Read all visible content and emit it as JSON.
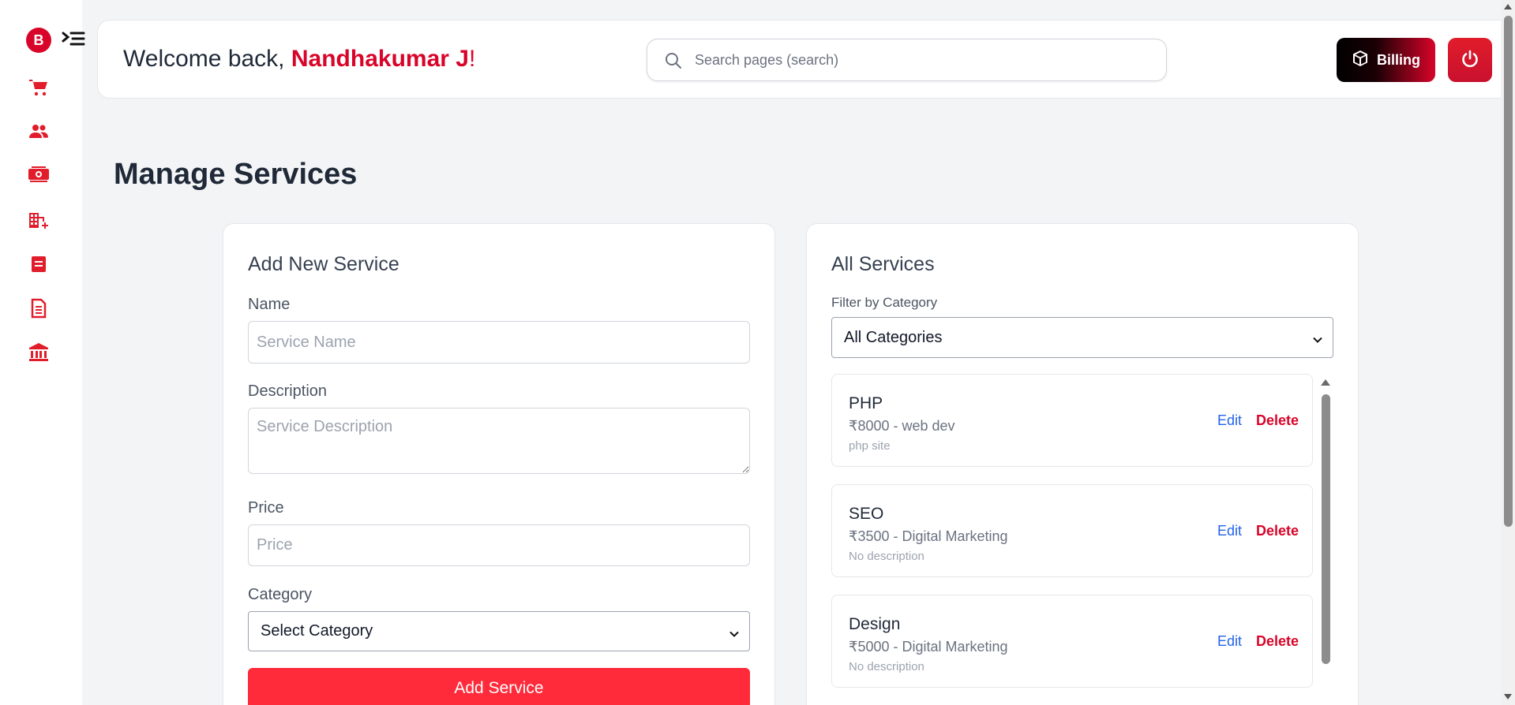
{
  "sidebar": {
    "logo_letter": "B",
    "items": [
      {
        "icon": "cart-icon"
      },
      {
        "icon": "users-icon"
      },
      {
        "icon": "money-icon"
      },
      {
        "icon": "building-add-icon"
      },
      {
        "icon": "document-icon"
      },
      {
        "icon": "invoice-icon"
      },
      {
        "icon": "bank-icon"
      }
    ]
  },
  "header": {
    "welcome_prefix": "Welcome back,",
    "user_name": "Nandhakumar J",
    "welcome_suffix": "!",
    "search_placeholder": "Search pages (search)",
    "billing_label": "Billing"
  },
  "page": {
    "title": "Manage Services"
  },
  "add_form": {
    "heading": "Add New Service",
    "name_label": "Name",
    "name_placeholder": "Service Name",
    "description_label": "Description",
    "description_placeholder": "Service Description",
    "price_label": "Price",
    "price_placeholder": "Price",
    "category_label": "Category",
    "category_selected": "Select Category",
    "submit_label": "Add Service"
  },
  "services": {
    "heading": "All Services",
    "filter_label": "Filter by Category",
    "filter_selected": "All Categories",
    "edit_label": "Edit",
    "delete_label": "Delete",
    "items": [
      {
        "name": "PHP",
        "price_line": "₹8000 - web dev",
        "description": "php site"
      },
      {
        "name": "SEO",
        "price_line": "₹3500 - Digital Marketing",
        "description": "No description"
      },
      {
        "name": "Design",
        "price_line": "₹5000 - Digital Marketing",
        "description": "No description"
      }
    ]
  },
  "colors": {
    "brand_red": "#d90429",
    "button_red": "#ff2a3a",
    "link_blue": "#2563eb"
  }
}
